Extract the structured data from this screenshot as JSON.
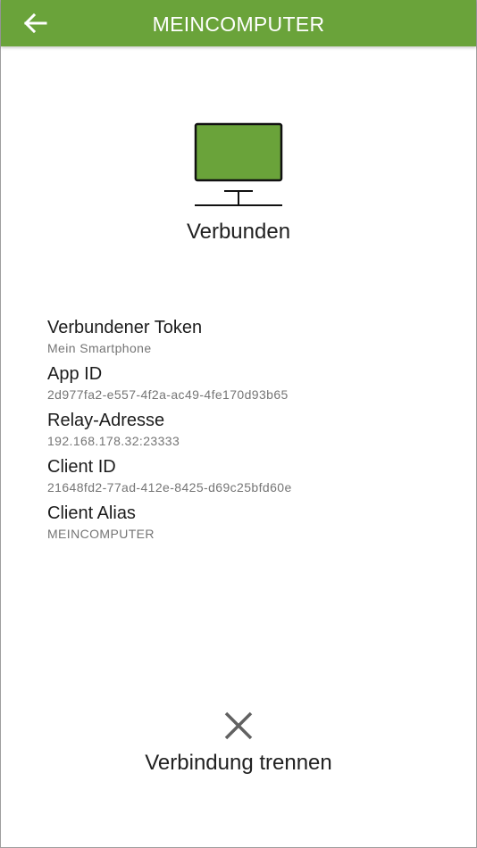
{
  "header": {
    "title": "MEINCOMPUTER",
    "back_icon": "arrow-left-icon",
    "background_color": "#6aa33a"
  },
  "status": {
    "icon": "monitor-icon",
    "text": "Verbunden",
    "screen_color": "#6aa33a"
  },
  "details": [
    {
      "label": "Verbundener Token",
      "value": "Mein Smartphone"
    },
    {
      "label": "App ID",
      "value": "2d977fa2-e557-4f2a-ac49-4fe170d93b65"
    },
    {
      "label": "Relay-Adresse",
      "value": "192.168.178.32:23333"
    },
    {
      "label": "Client ID",
      "value": "21648fd2-77ad-412e-8425-d69c25bfd60e"
    },
    {
      "label": "Client Alias",
      "value": "MEINCOMPUTER"
    }
  ],
  "disconnect": {
    "icon": "close-icon",
    "label": "Verbindung trennen"
  }
}
